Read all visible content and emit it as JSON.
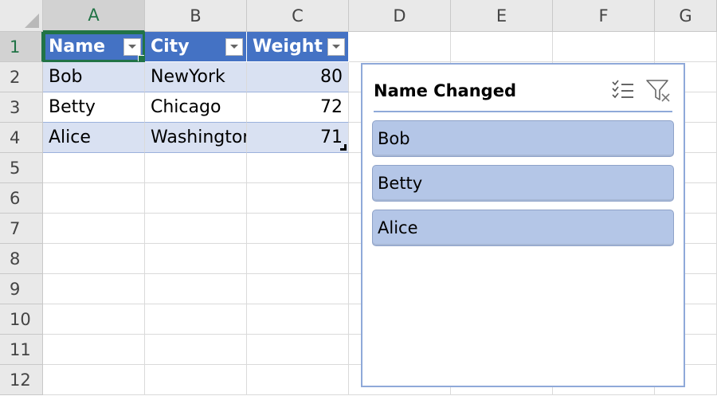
{
  "columns": [
    "A",
    "B",
    "C",
    "D",
    "E",
    "F",
    "G"
  ],
  "rows": [
    "1",
    "2",
    "3",
    "4",
    "5",
    "6",
    "7",
    "8",
    "9",
    "10",
    "11",
    "12"
  ],
  "table": {
    "headers": [
      "Name",
      "City",
      "Weight"
    ],
    "data": [
      [
        "Bob",
        "NewYork",
        "80"
      ],
      [
        "Betty",
        "Chicago",
        "72"
      ],
      [
        "Alice",
        "Washington",
        "71"
      ]
    ]
  },
  "slicer": {
    "title": "Name Changed",
    "items": [
      "Bob",
      "Betty",
      "Alice"
    ],
    "multi_select_icon": "multi-select-icon",
    "clear_filter_icon": "clear-filter-icon"
  },
  "colors": {
    "header_fill": "#4472c4",
    "band_fill": "#d9e1f2",
    "selection": "#217346",
    "slicer_item": "#b4c6e7",
    "slicer_border": "#8fa9d9"
  }
}
